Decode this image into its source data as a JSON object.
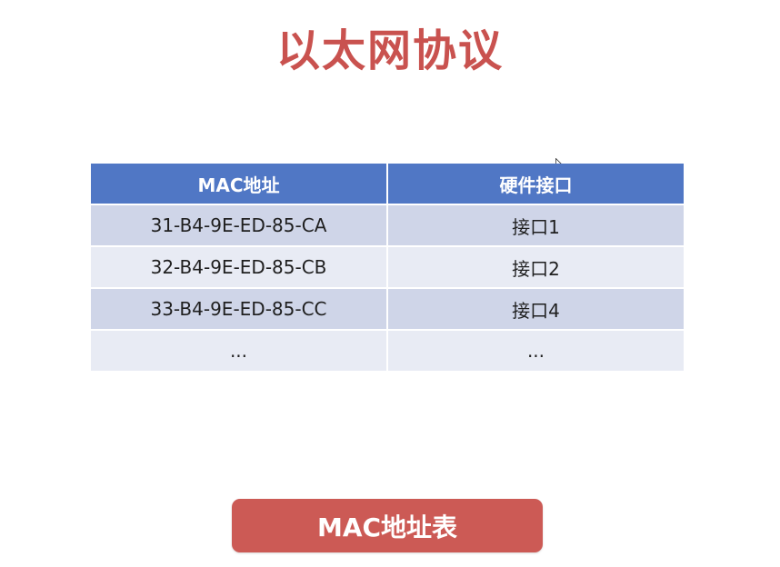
{
  "title": "以太网协议",
  "table": {
    "headers": [
      "MAC地址",
      "硬件接口"
    ],
    "rows": [
      [
        "31-B4-9E-ED-85-CA",
        "接口1"
      ],
      [
        "32-B4-9E-ED-85-CB",
        "接口2"
      ],
      [
        "33-B4-9E-ED-85-CC",
        "接口4"
      ],
      [
        "...",
        "..."
      ]
    ]
  },
  "button": {
    "label": "MAC地址表"
  },
  "colors": {
    "title": "#c9524f",
    "header_bg": "#5077c5",
    "row_odd": "#cfd5e8",
    "row_even": "#e8ebf4",
    "button_bg": "#cc5a55"
  },
  "icons": {
    "cursor": "mouse-cursor-icon"
  }
}
